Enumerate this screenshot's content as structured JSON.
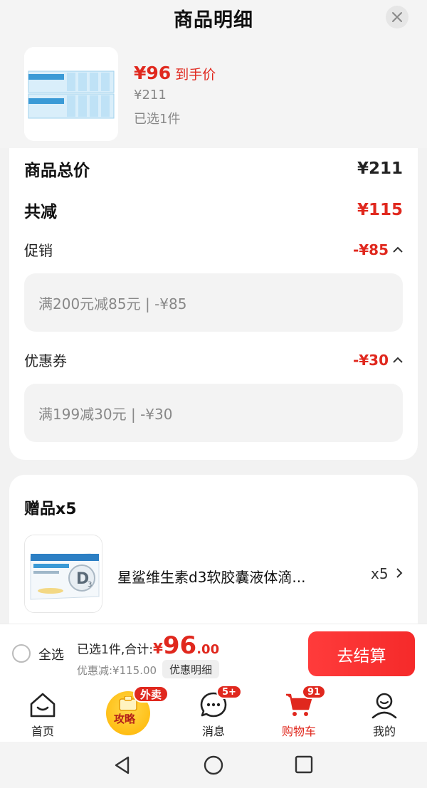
{
  "header": {
    "title": "商品明细"
  },
  "product": {
    "final_price": "¥96",
    "final_price_label": "到手价",
    "original_price": "¥211",
    "selected_count": "已选1件"
  },
  "price_detail": {
    "total_label": "商品总价",
    "total_value": "¥211",
    "reduction_label": "共减",
    "reduction_value": "¥115",
    "promotion_label": "促销",
    "promotion_value": "-¥85",
    "promotion_detail": "满200元减85元 | -¥85",
    "coupon_label": "优惠券",
    "coupon_value": "-¥30",
    "coupon_detail": "满199减30元 | -¥30"
  },
  "gift": {
    "title": "赠品x5",
    "name": "星鲨维生素d3软胶囊液体滴...",
    "quantity": "x5"
  },
  "checkout": {
    "select_all_label": "全选",
    "total_prefix": "已选1件,合计:",
    "currency": "¥",
    "total_integer": "96",
    "total_decimal": ".00",
    "discount_text": "优惠减:¥115.00",
    "detail_link": "优惠明细",
    "checkout_button": "去结算"
  },
  "tabs": [
    {
      "label": "首页",
      "icon": "home-icon"
    },
    {
      "label": "攻略",
      "icon": "promo-icon",
      "badge": "外卖"
    },
    {
      "label": "消息",
      "icon": "message-icon",
      "badge": "5+"
    },
    {
      "label": "购物车",
      "icon": "cart-icon",
      "badge": "91",
      "active": true
    },
    {
      "label": "我的",
      "icon": "profile-icon"
    }
  ],
  "colors": {
    "accent": "#e0281e",
    "checkout_button": "#f52a2a"
  }
}
